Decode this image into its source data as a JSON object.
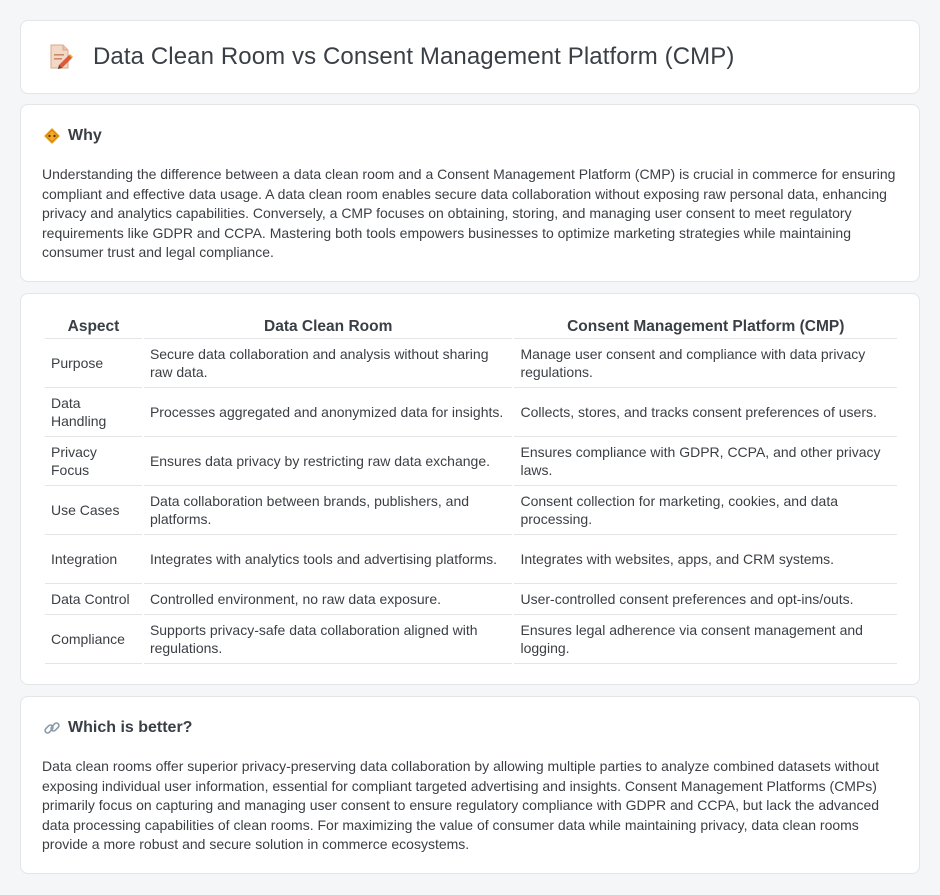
{
  "header": {
    "title": "Data Clean Room vs Consent Management Platform (CMP)",
    "icon": "document-pencil-icon"
  },
  "why": {
    "icon": "diamond-sign-icon",
    "title": "Why",
    "body": "Understanding the difference between a data clean room and a Consent Management Platform (CMP) is crucial in commerce for ensuring compliant and effective data usage. A data clean room enables secure data collaboration without exposing raw personal data, enhancing privacy and analytics capabilities. Conversely, a CMP focuses on obtaining, storing, and managing user consent to meet regulatory requirements like GDPR and CCPA. Mastering both tools empowers businesses to optimize marketing strategies while maintaining consumer trust and legal compliance."
  },
  "comparison": {
    "headers": [
      "Aspect",
      "Data Clean Room",
      "Consent Management Platform (CMP)"
    ],
    "rows": [
      {
        "aspect": "Purpose",
        "clean_room": "Secure data collaboration and analysis without sharing raw data.",
        "cmp": "Manage user consent and compliance with data privacy regulations."
      },
      {
        "aspect": "Data Handling",
        "clean_room": "Processes aggregated and anonymized data for insights.",
        "cmp": "Collects, stores, and tracks consent preferences of users."
      },
      {
        "aspect": "Privacy Focus",
        "clean_room": "Ensures data privacy by restricting raw data exchange.",
        "cmp": "Ensures compliance with GDPR, CCPA, and other privacy laws."
      },
      {
        "aspect": "Use Cases",
        "clean_room": "Data collaboration between brands, publishers, and platforms.",
        "cmp": "Consent collection for marketing, cookies, and data processing."
      },
      {
        "aspect": "Integration",
        "clean_room": "Integrates with analytics tools and advertising platforms.",
        "cmp": "Integrates with websites, apps, and CRM systems."
      },
      {
        "aspect": "Data Control",
        "clean_room": "Controlled environment, no raw data exposure.",
        "cmp": "User-controlled consent preferences and opt-ins/outs."
      },
      {
        "aspect": "Compliance",
        "clean_room": "Supports privacy-safe data collaboration aligned with regulations.",
        "cmp": "Ensures legal adherence via consent management and logging."
      }
    ]
  },
  "better": {
    "icon": "link-icon",
    "title": "Which is better?",
    "body": "Data clean rooms offer superior privacy-preserving data collaboration by allowing multiple parties to analyze combined datasets without exposing individual user information, essential for compliant targeted advertising and insights. Consent Management Platforms (CMPs) primarily focus on capturing and managing user consent to ensure regulatory compliance with GDPR and CCPA, but lack the advanced data processing capabilities of clean rooms. For maximizing the value of consumer data while maintaining privacy, data clean rooms provide a more robust and secure solution in commerce ecosystems."
  }
}
